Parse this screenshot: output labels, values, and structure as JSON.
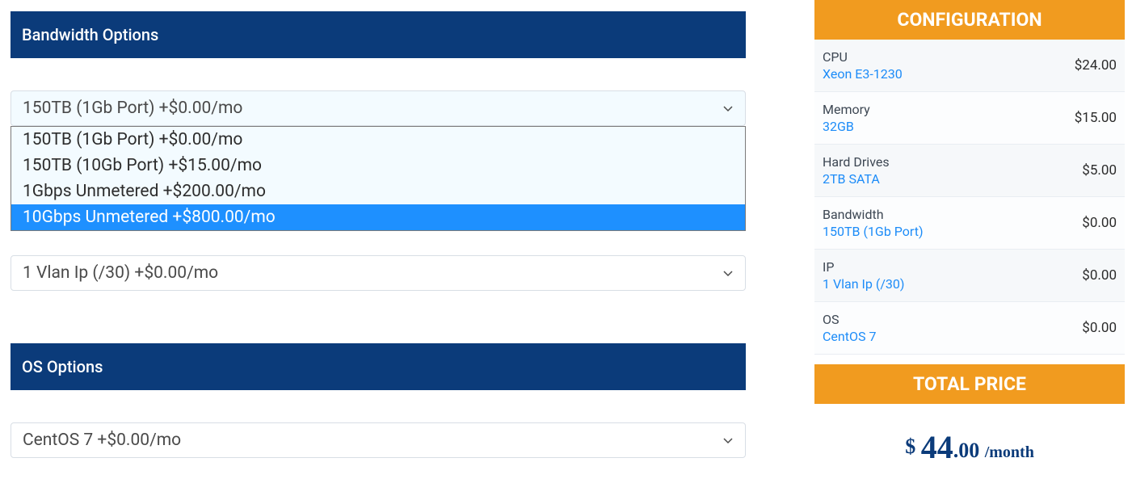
{
  "left": {
    "bandwidth": {
      "header": "Bandwidth Options",
      "selected": "150TB (1Gb Port) +$0.00/mo",
      "options": [
        "150TB (1Gb Port) +$0.00/mo",
        "150TB (10Gb Port) +$15.00/mo",
        "1Gbps Unmetered +$200.00/mo",
        "10Gbps Unmetered +$800.00/mo"
      ]
    },
    "ip": {
      "selected": "1 Vlan Ip (/30) +$0.00/mo"
    },
    "os": {
      "header": "OS Options",
      "selected": "CentOS 7 +$0.00/mo"
    }
  },
  "right": {
    "config_header": "CONFIGURATION",
    "rows": [
      {
        "label": "CPU",
        "value": "Xeon E3-1230",
        "price": "$24.00"
      },
      {
        "label": "Memory",
        "value": "32GB",
        "price": "$15.00"
      },
      {
        "label": "Hard Drives",
        "value": "2TB SATA",
        "price": "$5.00"
      },
      {
        "label": "Bandwidth",
        "value": "150TB (1Gb Port)",
        "price": "$0.00"
      },
      {
        "label": "IP",
        "value": "1 Vlan Ip (/30)",
        "price": "$0.00"
      },
      {
        "label": "OS",
        "value": "CentOS 7",
        "price": "$0.00"
      }
    ],
    "total_header": "TOTAL PRICE",
    "total": {
      "currency": "$ ",
      "big": "44",
      "cents": ".00 ",
      "suffix": "/month"
    }
  }
}
